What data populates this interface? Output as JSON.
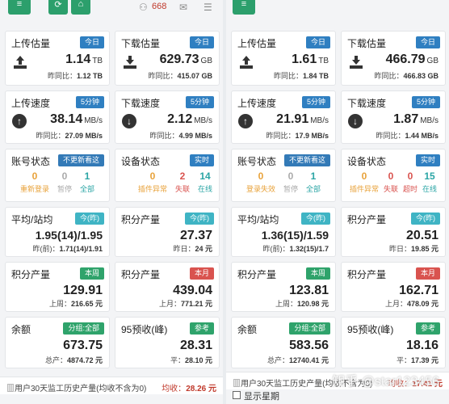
{
  "left": {
    "topbar": {
      "count": "668"
    },
    "cards": {
      "upload_est": {
        "title": "上传估量",
        "badge": "今日",
        "value": "1.14",
        "unit": "TB",
        "sub_label": "昨同比：",
        "sub_value": "1.12 TB"
      },
      "download_est": {
        "title": "下载估量",
        "badge": "今日",
        "value": "629.73",
        "unit": "GB",
        "sub_label": "昨同比：",
        "sub_value": "415.07 GB"
      },
      "upload_speed": {
        "title": "上传速度",
        "badge": "5分钟",
        "value": "38.14",
        "unit": "MB/s",
        "sub_label": "昨同比：",
        "sub_value": "27.09 MB/s"
      },
      "download_speed": {
        "title": "下载速度",
        "badge": "5分钟",
        "value": "2.12",
        "unit": "MB/s",
        "sub_label": "昨同比：",
        "sub_value": "4.99 MB/s"
      },
      "account_status": {
        "title": "账号状态",
        "badge": "不更新看这",
        "n1": "0",
        "l1": "重新登录",
        "n2": "0",
        "l2": "暂停",
        "n3": "1",
        "l3": "全部"
      },
      "device_status": {
        "title": "设备状态",
        "badge": "实时",
        "n1": "0",
        "l1": "插件异常",
        "n2": "2",
        "l2": "失联",
        "n3": "14",
        "l3": "在线"
      },
      "avg_per_station": {
        "title": "平均/站均",
        "badge": "今(昨)",
        "value": "1.95(14)/1.95",
        "sub_label": "昨(前)：",
        "sub_value": "1.71(14)/1.91"
      },
      "points_today": {
        "title": "积分产量",
        "badge": "今(昨)",
        "value": "27.37",
        "sub_label": "昨日：",
        "sub_value": "24 元"
      },
      "points_week": {
        "title": "积分产量",
        "badge": "本周",
        "value": "129.91",
        "sub_label": "上周：",
        "sub_value": "216.65 元"
      },
      "points_month": {
        "title": "积分产量",
        "badge": "本月",
        "value": "439.04",
        "sub_label": "上月：",
        "sub_value": "771.21 元"
      },
      "balance": {
        "title": "余额",
        "badge": "分组:全部",
        "value": "673.75",
        "sub_label": "总产：",
        "sub_value": "4874.72 元"
      },
      "p95": {
        "title": "95预收(峰)",
        "badge": "参考",
        "value": "28.31",
        "sub_label": "平：",
        "sub_value": "28.10 元"
      }
    },
    "footer": {
      "text": "用户30天监工历史产量(均收不含为0)",
      "avg_label": "均收：",
      "avg_value": "28.26 元"
    }
  },
  "right": {
    "cards": {
      "upload_est": {
        "title": "上传估量",
        "badge": "今日",
        "value": "1.61",
        "unit": "TB",
        "sub_label": "昨同比：",
        "sub_value": "1.84 TB"
      },
      "download_est": {
        "title": "下载估量",
        "badge": "今日",
        "value": "466.79",
        "unit": "GB",
        "sub_label": "昨同比：",
        "sub_value": "466.83 GB"
      },
      "upload_speed": {
        "title": "上传速度",
        "badge": "5分钟",
        "value": "21.91",
        "unit": "MB/s",
        "sub_label": "昨同比：",
        "sub_value": "17.9 MB/s"
      },
      "download_speed": {
        "title": "下载速度",
        "badge": "5分钟",
        "value": "1.87",
        "unit": "MB/s",
        "sub_label": "昨同比：",
        "sub_value": "1.44 MB/s"
      },
      "account_status": {
        "title": "账号状态",
        "badge": "不更新看这",
        "n1": "0",
        "l1": "登录失效",
        "n2": "0",
        "l2": "暂停",
        "n3": "1",
        "l3": "全部"
      },
      "device_status": {
        "title": "设备状态",
        "badge": "实时",
        "n1": "0",
        "l1": "插件异常",
        "n2": "0",
        "l2": "失联",
        "n3": "0",
        "l3": "超时",
        "n4": "15",
        "l4": "在线"
      },
      "avg_per_station": {
        "title": "平均/站均",
        "badge": "今(昨)",
        "value": "1.36(15)/1.59",
        "sub_label": "昨(前)：",
        "sub_value": "1.32(15)/1.7"
      },
      "points_today": {
        "title": "积分产量",
        "badge": "今(昨)",
        "value": "20.51",
        "sub_label": "昨日：",
        "sub_value": "19.85 元"
      },
      "points_week": {
        "title": "积分产量",
        "badge": "本周",
        "value": "123.81",
        "sub_label": "上周：",
        "sub_value": "120.98 元"
      },
      "points_month": {
        "title": "积分产量",
        "badge": "本月",
        "value": "162.71",
        "sub_label": "上月：",
        "sub_value": "478.09 元"
      },
      "balance": {
        "title": "余额",
        "badge": "分组:全部",
        "value": "583.56",
        "sub_label": "总产：",
        "sub_value": "12740.41 元"
      },
      "p95": {
        "title": "95预收(峰)",
        "badge": "参考",
        "value": "18.16",
        "sub_label": "平：",
        "sub_value": "17.39 元"
      }
    },
    "footer": {
      "text": "用户30天监工历史产量(均收不含为0)",
      "avg_label": "均收：",
      "avg_value": "17.41 元"
    },
    "checkbox_label": "显示星期",
    "watermark": "知乎 @star123456"
  }
}
